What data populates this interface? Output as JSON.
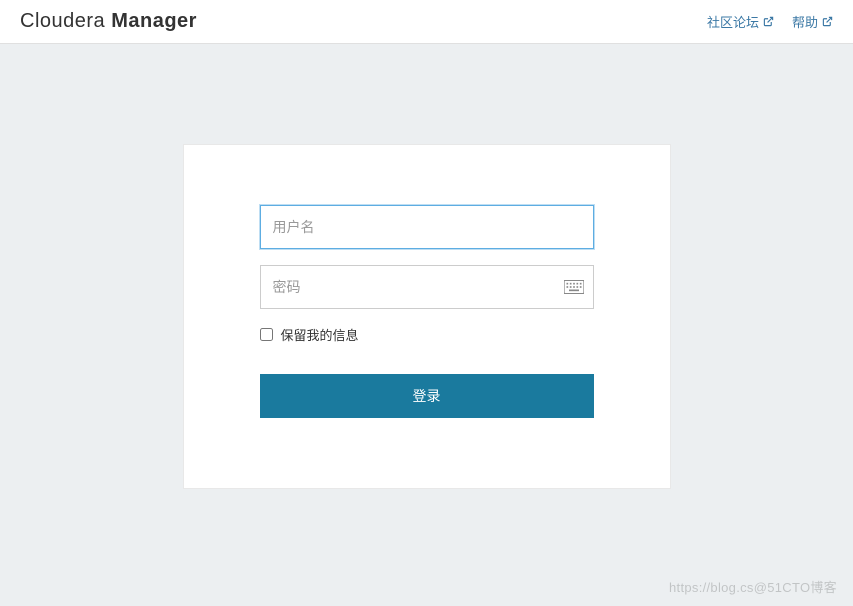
{
  "header": {
    "brand_light": "Cloudera ",
    "brand_bold": "Manager",
    "links": {
      "community": "社区论坛",
      "help": "帮助"
    }
  },
  "login": {
    "username_placeholder": "用户名",
    "password_placeholder": "密码",
    "remember_label": "保留我的信息",
    "submit_label": "登录"
  },
  "watermark": "https://blog.cs@51CTO博客"
}
